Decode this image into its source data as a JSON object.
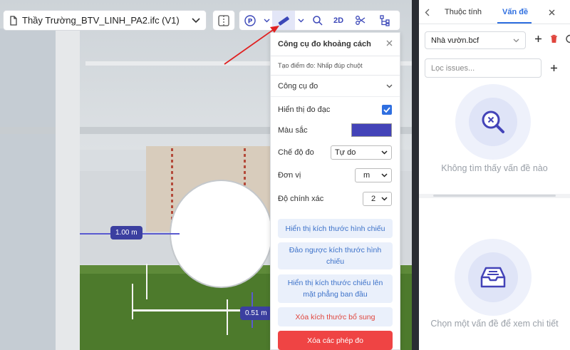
{
  "file": {
    "title": "Thầy Trường_BTV_LINH_PA2.ifc (V1)"
  },
  "toolbar": {
    "twod_label": "2D"
  },
  "measure_labels": {
    "first": "1.00 m",
    "second": "0.51 m"
  },
  "panel": {
    "title": "Công cụ đo khoảng cách",
    "hint": "Tạo điểm đo: Nhấp đúp chuột",
    "section_label": "Công cụ đo",
    "show_measure_label": "Hiển thị đo đạc",
    "show_measure_checked": true,
    "color_label": "Màu sắc",
    "color_value": "#4343b8",
    "mode_label": "Chế độ đo",
    "mode_value": "Tự do",
    "unit_label": "Đơn vị",
    "unit_value": "m",
    "precision_label": "Độ chính xác",
    "precision_value": "2",
    "btn_show_projection": "Hiển thị kích thước hình chiếu",
    "btn_reverse_projection": "Đảo ngược kích thước hình chiếu",
    "btn_show_on_plane": "Hiển thị kích thước chiếu lên mặt phẳng ban đầu",
    "btn_delete_extra": "Xóa kích thước bổ sung",
    "btn_delete_all": "Xóa các phép đo"
  },
  "side": {
    "tab_properties": "Thuộc tính",
    "tab_issues": "Vấn đề",
    "bcf_file": "Nhà vườn.bcf",
    "filter_placeholder": "Lọc issues...",
    "empty_issues": "Không tìm thấy vấn đề nào",
    "select_issue": "Chọn một vấn đề để xem chi tiết"
  },
  "colors": {
    "accent": "#2f6fe0",
    "danger": "#ef4444",
    "measure": "#3b3fa0"
  }
}
